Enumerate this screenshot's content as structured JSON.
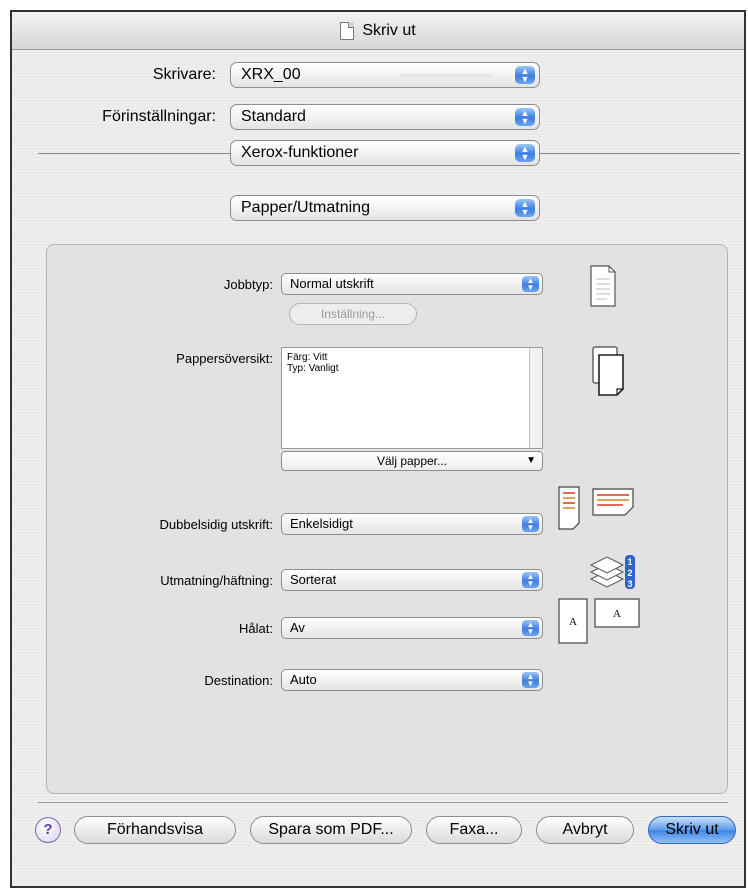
{
  "window": {
    "title": "Skriv ut"
  },
  "printer": {
    "label": "Skrivare:",
    "value": "XRX_00"
  },
  "presets": {
    "label": "Förinställningar:",
    "value": "Standard"
  },
  "feature_set": {
    "value": "Xerox-funktioner"
  },
  "feature_page": {
    "value": "Papper/Utmatning"
  },
  "panel": {
    "job_type": {
      "label": "Jobbtyp:",
      "value": "Normal utskrift",
      "setup_button": "Inställning..."
    },
    "paper_summary": {
      "label": "Pappersöversikt:",
      "lines": [
        "Färg: Vitt",
        "Typ: Vanligt"
      ],
      "select_paper_button": "Välj papper..."
    },
    "duplex": {
      "label": "Dubbelsidig utskrift:",
      "value": "Enkelsidigt"
    },
    "output": {
      "label": "Utmatning/häftning:",
      "value": "Sorterat"
    },
    "punch": {
      "label": "Hålat:",
      "value": "Av",
      "icon_letter": "A"
    },
    "destination": {
      "label": "Destination:",
      "value": "Auto"
    }
  },
  "buttons": {
    "help": "?",
    "preview": "Förhandsvisa",
    "save_pdf": "Spara som PDF...",
    "fax": "Faxa...",
    "cancel": "Avbryt",
    "print": "Skriv ut"
  },
  "colors": {
    "accent_blue": "#3e7fe0",
    "panel_bg": "#e2e2e2",
    "window_bg": "#ececec"
  }
}
